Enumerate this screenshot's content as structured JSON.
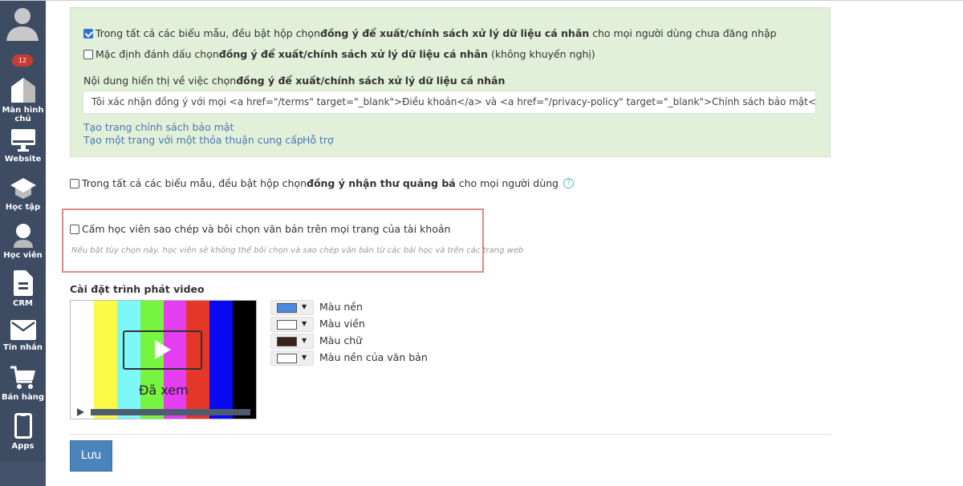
{
  "sidebar": {
    "badge": "12",
    "items": [
      {
        "label": "Màn hình chủ",
        "icon": "home-icon"
      },
      {
        "label": "Website",
        "icon": "monitor-icon"
      },
      {
        "label": "Học tập",
        "icon": "graduation-cap-icon"
      },
      {
        "label": "Học viên",
        "icon": "user-icon"
      },
      {
        "label": "CRM",
        "icon": "document-icon"
      },
      {
        "label": "Tin nhắn",
        "icon": "envelope-icon"
      },
      {
        "label": "Bán hàng",
        "icon": "cart-icon"
      },
      {
        "label": "Apps",
        "icon": "phone-icon"
      }
    ]
  },
  "consent": {
    "opt1": {
      "checked": true,
      "pre": "Trong tất cả các biểu mẫu, đều bật hộp chọn ",
      "bold": "đồng ý để xuất/chính sách xử lý dữ liệu cá nhân",
      "post": " cho mọi người dùng chưa đăng nhập"
    },
    "opt2": {
      "checked": false,
      "pre": "Mặc định đánh dấu chọn ",
      "bold": "đồng ý để xuất/chính sách xử lý dữ liệu cá nhân",
      "post": " (không khuyến nghị)"
    },
    "label_pre": "Nội dung hiển thị về việc chọn ",
    "label_bold": "đồng ý để xuất/chính sách xử lý dữ liệu cá nhân",
    "input_value": "Tôi xác nhận đồng ý với mọi <a href=\"/terms\" target=\"_blank\">Điều khoản</a> và <a href=\"/privacy-policy\" target=\"_blank\">Chính sách bảo mật</a>",
    "link_privacy": "Tạo trang chính sách bảo mật",
    "link_agreement": "Tạo một trang với một thỏa thuận cung cấp",
    "link_support": "Hỗ trợ"
  },
  "promo": {
    "checked": false,
    "pre": "Trong tất cả các biểu mẫu, đều bật hộp chọn ",
    "bold": "đồng ý nhận thư quảng bá",
    "post": " cho mọi người dùng"
  },
  "copy_protect": {
    "checked": false,
    "label": "Cấm học viên sao chép và bôi chọn văn bản trên mọi trang của tài khoản",
    "hint": "Nếu bật tùy chọn này, học viên sẽ không thể bôi chọn và sao chép văn bản từ các bài học và trên các trang web"
  },
  "video": {
    "title": "Cài đặt trình phát video",
    "watched": "Đã xem",
    "bars": [
      "#ffffff",
      "#fbfb47",
      "#7cf8f8",
      "#76f440",
      "#e33ef0",
      "#e5362a",
      "#0a0af2",
      "#000000"
    ],
    "colors": [
      {
        "label": "Màu nền",
        "value": "#4a8be0"
      },
      {
        "label": "Màu viền",
        "value": "#ffffff"
      },
      {
        "label": "Màu chữ",
        "value": "#3a2218"
      },
      {
        "label": "Màu nền của văn bản",
        "value": "#ffffff"
      }
    ]
  },
  "save_label": "Lưu"
}
